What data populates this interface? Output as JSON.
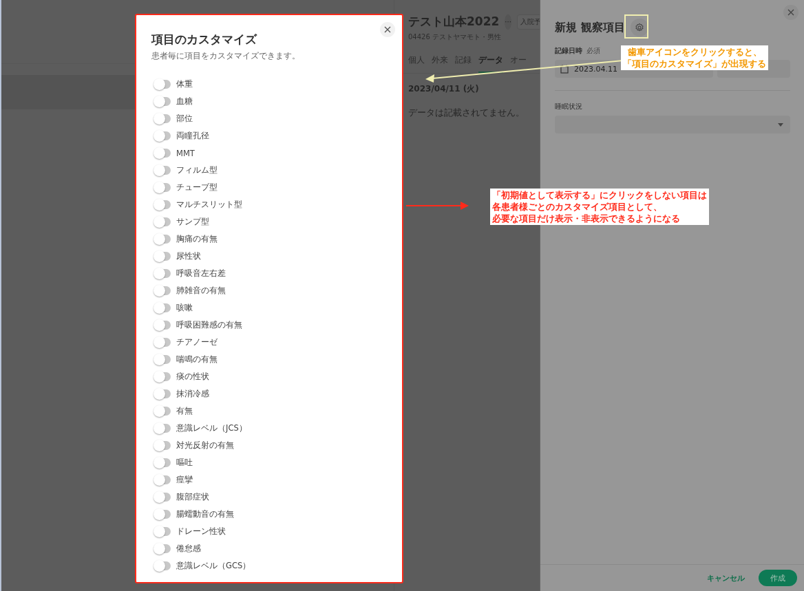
{
  "patient": {
    "name": "テスト山本2022",
    "more": "···",
    "status_chip": "入院予",
    "info": "04426 テストヤマモト・男性",
    "tabs": [
      {
        "label": "個人",
        "selected": false
      },
      {
        "label": "外来",
        "selected": false
      },
      {
        "label": "記録",
        "selected": false
      },
      {
        "label": "データ",
        "selected": true
      },
      {
        "label": "オー",
        "selected": false
      }
    ],
    "date": "2023/04/11 (火)",
    "empty_message": "データは記載されてません。"
  },
  "drawer": {
    "title": "新規 観察項目",
    "date_label": "記録日時",
    "required": "必須",
    "date_value": "2023.04.11",
    "sleep_label": "睡眠状況",
    "cancel": "キャンセル",
    "create": "作成"
  },
  "modal": {
    "title": "項目のカスタマイズ",
    "subtitle": "患者毎に項目をカスタマイズできます。",
    "items": [
      {
        "label": "体重",
        "on": false
      },
      {
        "label": "血糖",
        "on": false
      },
      {
        "label": "部位",
        "on": false
      },
      {
        "label": "両瞳孔径",
        "on": false
      },
      {
        "label": "MMT",
        "on": false
      },
      {
        "label": "フィルム型",
        "on": false
      },
      {
        "label": "チューブ型",
        "on": false
      },
      {
        "label": "マルチスリット型",
        "on": false
      },
      {
        "label": "サンプ型",
        "on": false
      },
      {
        "label": "胸痛の有無",
        "on": false
      },
      {
        "label": "尿性状",
        "on": false
      },
      {
        "label": "呼吸音左右差",
        "on": false
      },
      {
        "label": "肺雑音の有無",
        "on": false
      },
      {
        "label": "咳嗽",
        "on": false
      },
      {
        "label": "呼吸困難感の有無",
        "on": false
      },
      {
        "label": "チアノーゼ",
        "on": false
      },
      {
        "label": "喘鳴の有無",
        "on": false
      },
      {
        "label": "痰の性状",
        "on": false
      },
      {
        "label": "抹消冷感",
        "on": false
      },
      {
        "label": "有無",
        "on": false
      },
      {
        "label": "意識レベル（JCS）",
        "on": false
      },
      {
        "label": "対光反射の有無",
        "on": false
      },
      {
        "label": "嘔吐",
        "on": false
      },
      {
        "label": "痙攣",
        "on": false
      },
      {
        "label": "腹部症状",
        "on": false
      },
      {
        "label": "腸蠕動音の有無",
        "on": false
      },
      {
        "label": "ドレーン性状",
        "on": false
      },
      {
        "label": "倦怠感",
        "on": false
      },
      {
        "label": "意識レベル（GCS）",
        "on": false
      }
    ]
  },
  "annotations": [
    {
      "kind": "gear",
      "lines": [
        "歯車アイコンをクリックすると、",
        "「項目のカスタマイズ」が出現する"
      ]
    },
    {
      "kind": "note",
      "lines": [
        "「初期値として表示する」にクリックをしない項目は",
        "各患者様ごとのカスタマイズ項目として、",
        "必要な項目だけ表示・非表示できるようになる"
      ]
    }
  ]
}
